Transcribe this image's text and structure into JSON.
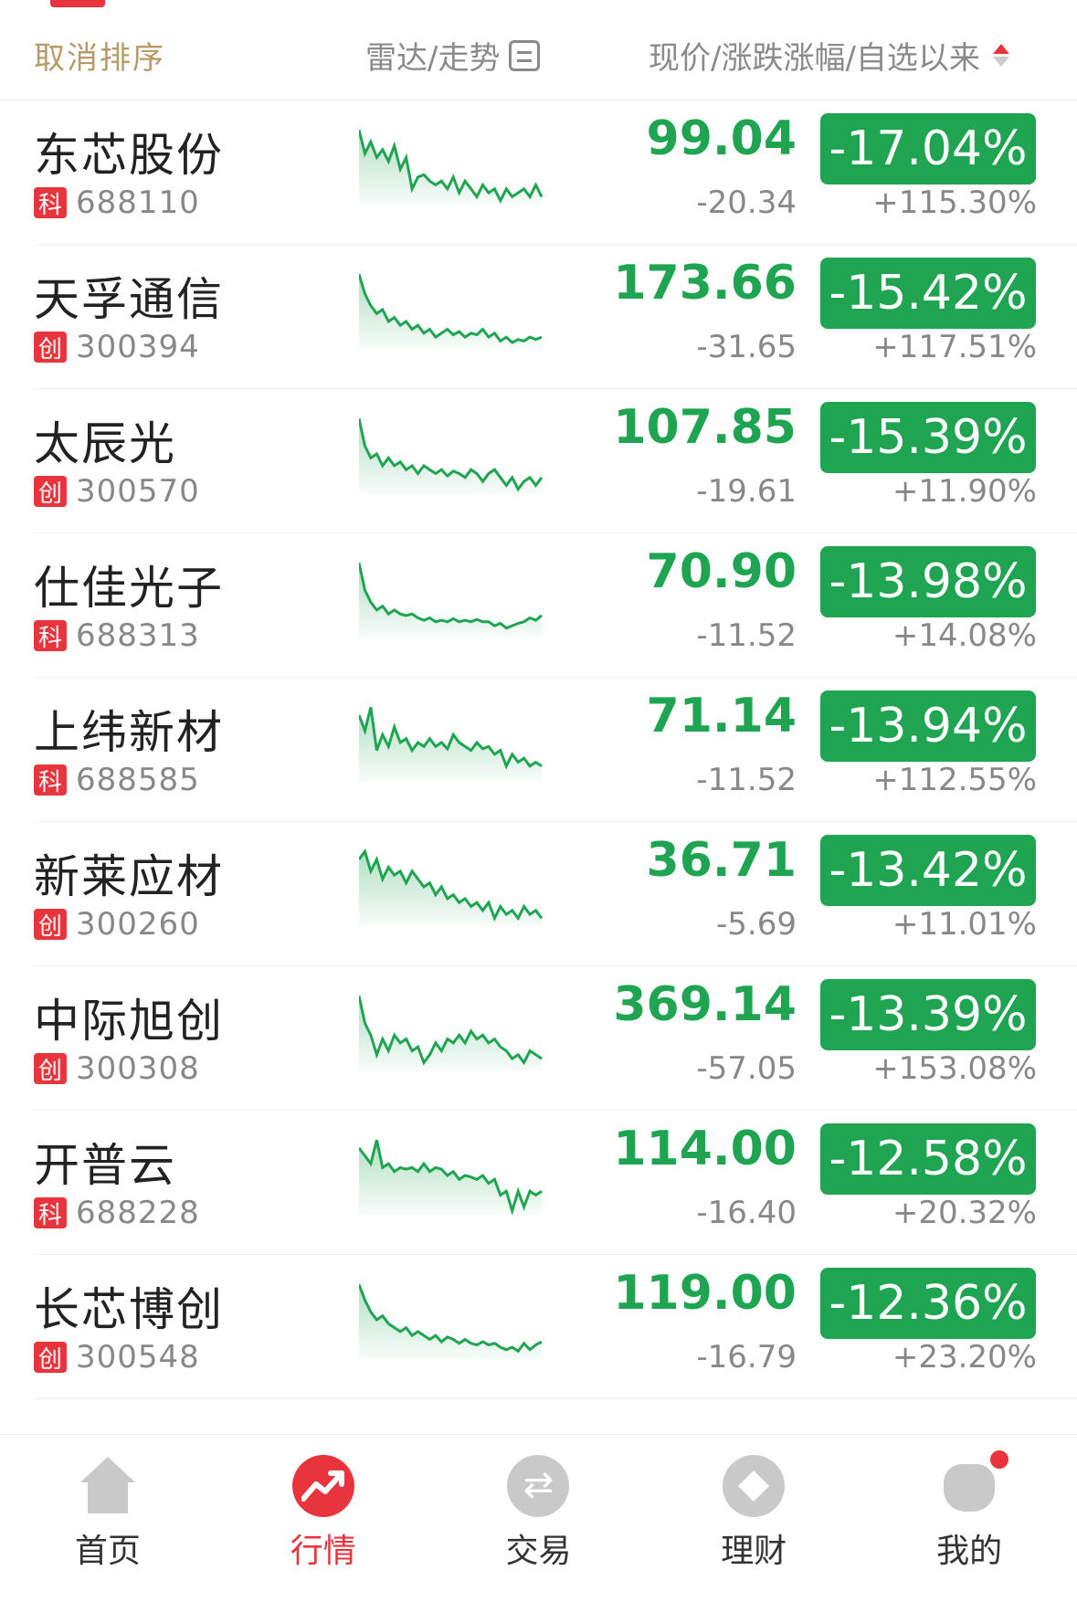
{
  "header": {
    "cancel_sort": "取消排序",
    "radar_trend": "雷达/走势",
    "price_columns": "现价/涨跌涨幅/自选以来"
  },
  "stocks": [
    {
      "name": "东芯股份",
      "board": "科",
      "code": "688110",
      "price": "99.04",
      "change": "-20.34",
      "pct": "-17.04%",
      "since": "+115.30%",
      "trend": [
        0.95,
        0.65,
        0.8,
        0.6,
        0.7,
        0.55,
        0.75,
        0.45,
        0.6,
        0.2,
        0.35,
        0.38,
        0.3,
        0.25,
        0.3,
        0.2,
        0.35,
        0.15,
        0.3,
        0.2,
        0.1,
        0.25,
        0.15,
        0.2,
        0.05,
        0.2,
        0.1,
        0.15,
        0.2,
        0.1,
        0.25,
        0.1
      ]
    },
    {
      "name": "天孚通信",
      "board": "创",
      "code": "300394",
      "price": "173.66",
      "change": "-31.65",
      "pct": "-15.42%",
      "since": "+117.51%",
      "trend": [
        0.95,
        0.7,
        0.55,
        0.45,
        0.5,
        0.35,
        0.4,
        0.3,
        0.35,
        0.25,
        0.3,
        0.2,
        0.25,
        0.15,
        0.2,
        0.25,
        0.18,
        0.22,
        0.15,
        0.2,
        0.18,
        0.25,
        0.15,
        0.2,
        0.1,
        0.15,
        0.08,
        0.12,
        0.1,
        0.15,
        0.12,
        0.15
      ]
    },
    {
      "name": "太辰光",
      "board": "创",
      "code": "300570",
      "price": "107.85",
      "change": "-19.61",
      "pct": "-15.39%",
      "since": "+11.90%",
      "trend": [
        0.95,
        0.6,
        0.45,
        0.5,
        0.35,
        0.45,
        0.35,
        0.4,
        0.3,
        0.35,
        0.25,
        0.35,
        0.3,
        0.25,
        0.3,
        0.22,
        0.28,
        0.25,
        0.2,
        0.3,
        0.25,
        0.15,
        0.25,
        0.3,
        0.2,
        0.1,
        0.2,
        0.05,
        0.15,
        0.2,
        0.1,
        0.2
      ]
    },
    {
      "name": "仕佳光子",
      "board": "科",
      "code": "688313",
      "price": "70.90",
      "change": "-11.52",
      "pct": "-13.98%",
      "since": "+14.08%",
      "trend": [
        0.95,
        0.6,
        0.45,
        0.35,
        0.4,
        0.3,
        0.35,
        0.3,
        0.28,
        0.3,
        0.25,
        0.22,
        0.25,
        0.2,
        0.22,
        0.2,
        0.24,
        0.2,
        0.22,
        0.2,
        0.23,
        0.2,
        0.2,
        0.15,
        0.18,
        0.12,
        0.15,
        0.18,
        0.2,
        0.25,
        0.22,
        0.28
      ]
    },
    {
      "name": "上纬新材",
      "board": "科",
      "code": "688585",
      "price": "71.14",
      "change": "-11.52",
      "pct": "-13.94%",
      "since": "+112.55%",
      "trend": [
        0.85,
        0.65,
        0.95,
        0.4,
        0.6,
        0.45,
        0.7,
        0.5,
        0.55,
        0.4,
        0.5,
        0.45,
        0.55,
        0.45,
        0.5,
        0.42,
        0.6,
        0.5,
        0.45,
        0.4,
        0.5,
        0.42,
        0.45,
        0.35,
        0.4,
        0.2,
        0.35,
        0.25,
        0.3,
        0.2,
        0.25,
        0.2
      ]
    },
    {
      "name": "新莱应材",
      "board": "创",
      "code": "300260",
      "price": "36.71",
      "change": "-5.69",
      "pct": "-13.42%",
      "since": "+11.01%",
      "trend": [
        0.85,
        0.95,
        0.7,
        0.85,
        0.6,
        0.75,
        0.65,
        0.7,
        0.55,
        0.7,
        0.6,
        0.5,
        0.55,
        0.4,
        0.5,
        0.35,
        0.4,
        0.3,
        0.35,
        0.25,
        0.3,
        0.2,
        0.3,
        0.1,
        0.25,
        0.15,
        0.2,
        0.1,
        0.25,
        0.15,
        0.2,
        0.1
      ]
    },
    {
      "name": "中际旭创",
      "board": "创",
      "code": "300308",
      "price": "369.14",
      "change": "-57.05",
      "pct": "-13.39%",
      "since": "+153.08%",
      "trend": [
        0.95,
        0.6,
        0.45,
        0.2,
        0.4,
        0.25,
        0.45,
        0.35,
        0.4,
        0.25,
        0.3,
        0.1,
        0.2,
        0.35,
        0.25,
        0.4,
        0.35,
        0.45,
        0.35,
        0.5,
        0.4,
        0.45,
        0.35,
        0.4,
        0.3,
        0.25,
        0.15,
        0.2,
        0.1,
        0.25,
        0.2,
        0.15
      ]
    },
    {
      "name": "开普云",
      "board": "科",
      "code": "688228",
      "price": "114.00",
      "change": "-16.40",
      "pct": "-12.58%",
      "since": "+20.32%",
      "trend": [
        0.85,
        0.75,
        0.65,
        0.95,
        0.6,
        0.65,
        0.55,
        0.6,
        0.58,
        0.6,
        0.55,
        0.65,
        0.55,
        0.6,
        0.58,
        0.5,
        0.55,
        0.45,
        0.5,
        0.48,
        0.45,
        0.5,
        0.4,
        0.45,
        0.25,
        0.3,
        0.05,
        0.3,
        0.1,
        0.3,
        0.25,
        0.3
      ]
    },
    {
      "name": "长芯博创",
      "board": "创",
      "code": "300548",
      "price": "119.00",
      "change": "-16.79",
      "pct": "-12.36%",
      "since": "+23.20%",
      "trend": [
        0.95,
        0.75,
        0.6,
        0.5,
        0.55,
        0.45,
        0.4,
        0.35,
        0.4,
        0.3,
        0.35,
        0.3,
        0.25,
        0.3,
        0.22,
        0.28,
        0.25,
        0.2,
        0.25,
        0.2,
        0.18,
        0.22,
        0.18,
        0.2,
        0.15,
        0.12,
        0.15,
        0.1,
        0.2,
        0.12,
        0.18,
        0.22
      ]
    }
  ],
  "tabs": [
    {
      "label": "首页",
      "icon": "home-icon",
      "active": false
    },
    {
      "label": "行情",
      "icon": "market-trend-icon",
      "active": true
    },
    {
      "label": "交易",
      "icon": "exchange-icon",
      "active": false
    },
    {
      "label": "理财",
      "icon": "finance-icon",
      "active": false
    },
    {
      "label": "我的",
      "icon": "profile-icon",
      "active": false,
      "notification": true
    }
  ],
  "colors": {
    "down": "#1fa551",
    "accent": "#e8343c",
    "sort_text": "#b89a66"
  }
}
